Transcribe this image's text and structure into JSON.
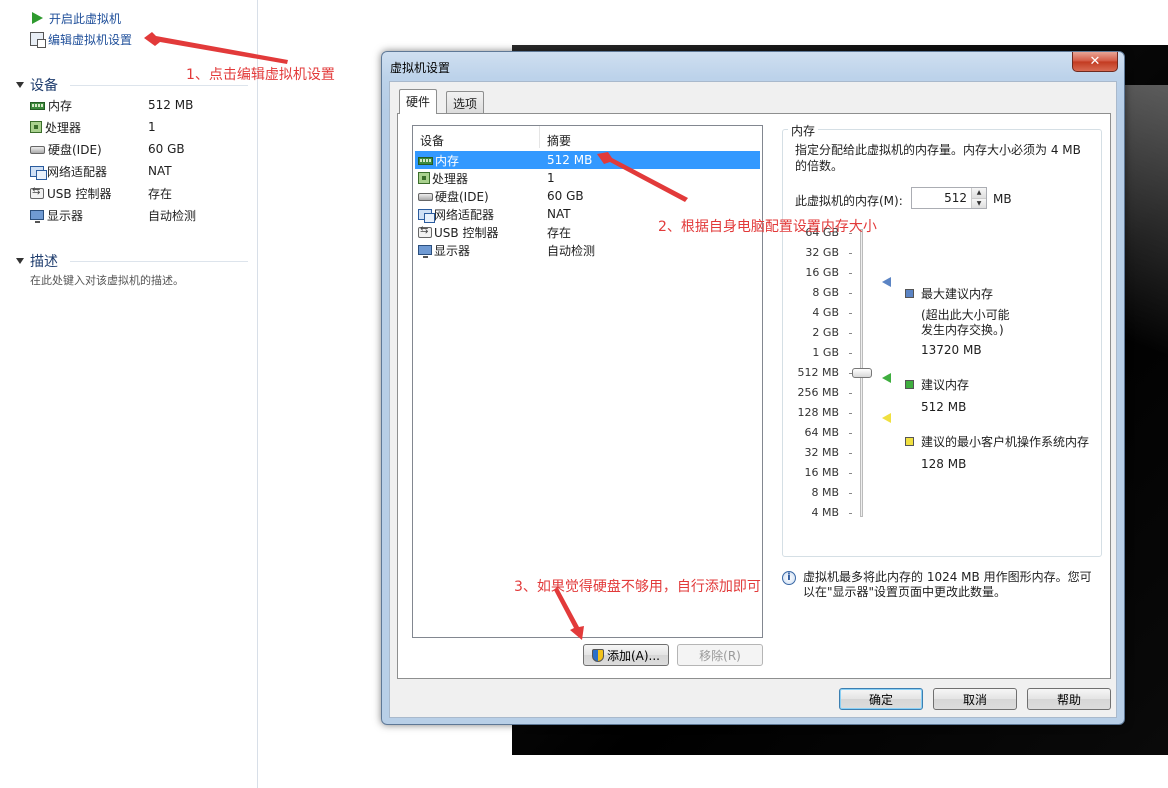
{
  "left_panel": {
    "commands": [
      {
        "label": "开启此虚拟机",
        "icon": "play-icon"
      },
      {
        "label": "编辑虚拟机设置",
        "icon": "edit-settings-icon"
      }
    ],
    "devices_title": "设备",
    "devices": [
      {
        "name": "内存",
        "value": "512 MB",
        "icon": "memory-icon"
      },
      {
        "name": "处理器",
        "value": "1",
        "icon": "processor-icon"
      },
      {
        "name": "硬盘(IDE)",
        "value": "60 GB",
        "icon": "hard-disk-icon"
      },
      {
        "name": "网络适配器",
        "value": "NAT",
        "icon": "network-adapter-icon"
      },
      {
        "name": "USB 控制器",
        "value": "存在",
        "icon": "usb-controller-icon"
      },
      {
        "name": "显示器",
        "value": "自动检测",
        "icon": "display-icon"
      }
    ],
    "description_title": "描述",
    "description_placeholder": "在此处键入对该虚拟机的描述。"
  },
  "annotations": {
    "step1": "1、点击编辑虚拟机设置",
    "step2": "2、根据自身电脑配置设置内存大小",
    "step3": "3、如果觉得硬盘不够用，自行添加即可",
    "color": "#e23a3a"
  },
  "dialog": {
    "title": "虚拟机设置",
    "close_label": "✕",
    "tabs": [
      {
        "label": "硬件",
        "active": true
      },
      {
        "label": "选项",
        "active": false
      }
    ],
    "device_list": {
      "headers": [
        "设备",
        "摘要"
      ],
      "rows": [
        {
          "device": "内存",
          "summary": "512 MB",
          "icon": "memory-icon",
          "selected": true
        },
        {
          "device": "处理器",
          "summary": "1",
          "icon": "processor-icon",
          "selected": false
        },
        {
          "device": "硬盘(IDE)",
          "summary": "60 GB",
          "icon": "hard-disk-icon",
          "selected": false
        },
        {
          "device": "网络适配器",
          "summary": "NAT",
          "icon": "network-adapter-icon",
          "selected": false
        },
        {
          "device": "USB 控制器",
          "summary": "存在",
          "icon": "usb-controller-icon",
          "selected": false
        },
        {
          "device": "显示器",
          "summary": "自动检测",
          "icon": "display-icon",
          "selected": false
        }
      ]
    },
    "add_button": "添加(A)...",
    "remove_button": "移除(R)",
    "memory": {
      "group_title": "内存",
      "description": "指定分配给此虚拟机的内存量。内存大小必须为 4 MB 的倍数。",
      "field_label": "此虚拟机的内存(M):",
      "value": "512",
      "unit": "MB",
      "scale_labels": [
        "64 GB",
        "32 GB",
        "16 GB",
        "8 GB",
        "4 GB",
        "2 GB",
        "1 GB",
        "512 MB",
        "256 MB",
        "128 MB",
        "64 MB",
        "32 MB",
        "16 MB",
        "8 MB",
        "4 MB"
      ],
      "legend": {
        "max_title": "最大建议内存",
        "max_note_line1": "(超出此大小可能",
        "max_note_line2": "发生内存交换。)",
        "max_value": "13720 MB",
        "rec_title": "建议内存",
        "rec_value": "512 MB",
        "min_title": "建议的最小客户机操作系统内存",
        "min_value": "128 MB"
      },
      "colors": {
        "max": "#5b84c4",
        "recommended": "#3fae3f",
        "minimum": "#f0e040"
      },
      "info": "虚拟机最多将此内存的 1024 MB 用作图形内存。您可以在\"显示器\"设置页面中更改此数量。"
    },
    "ok_button": "确定",
    "cancel_button": "取消",
    "help_button": "帮助"
  }
}
